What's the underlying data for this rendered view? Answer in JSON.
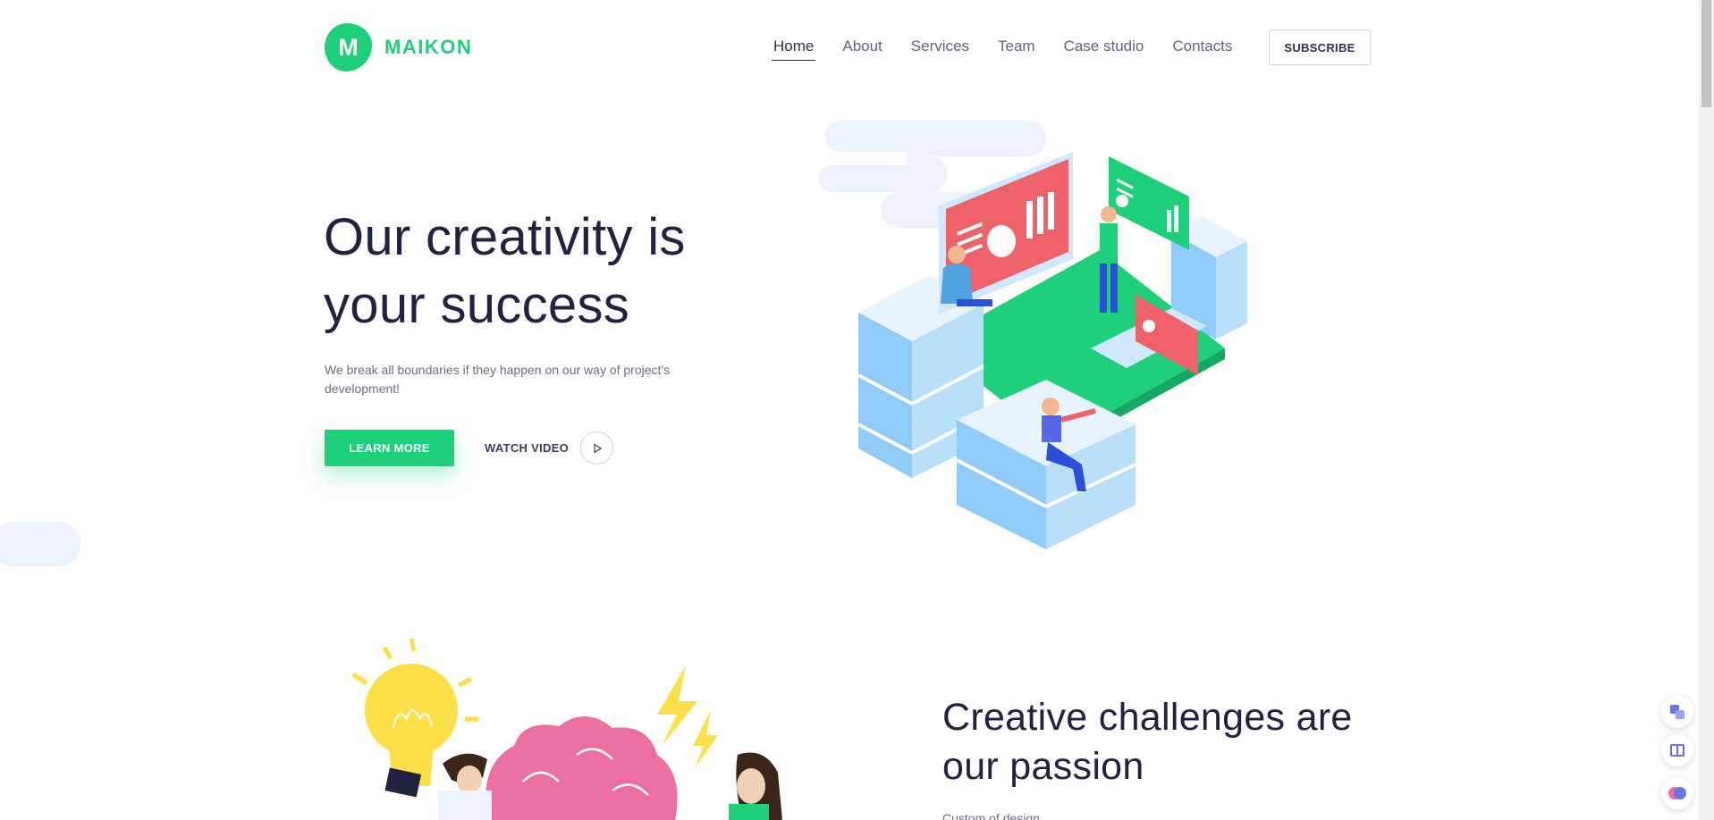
{
  "brand": {
    "logo_letter": "M",
    "name": "MAIKON",
    "color": "#1ed07a"
  },
  "nav": {
    "items": [
      {
        "label": "Home",
        "active": true
      },
      {
        "label": "About"
      },
      {
        "label": "Services"
      },
      {
        "label": "Team"
      },
      {
        "label": "Case studio"
      },
      {
        "label": "Contacts"
      }
    ],
    "subscribe_label": "SUBSCRIBE"
  },
  "hero": {
    "title_line1": "Our creativity is",
    "title_line2": "your success",
    "subtitle": "We break all boundaries if they happen on our way of project's development!",
    "learn_more_label": "LEARN MORE",
    "watch_video_label": "WATCH VIDEO",
    "illustration_icon": "isometric-team-illustration"
  },
  "section2": {
    "title_line1": "Creative challenges are",
    "title_line2": "our passion",
    "text": "Custom of design…",
    "illustration_icon": "brain-lightbulb-illustration"
  },
  "floating": [
    {
      "icon": "translate-icon"
    },
    {
      "icon": "reader-icon"
    },
    {
      "icon": "brain-extension-icon"
    }
  ],
  "colors": {
    "accent": "#1ed07a",
    "text_dark": "#1f2340",
    "text_muted": "#6a6f88",
    "light_blue": "#8ecbf7",
    "coral": "#f0626a"
  }
}
